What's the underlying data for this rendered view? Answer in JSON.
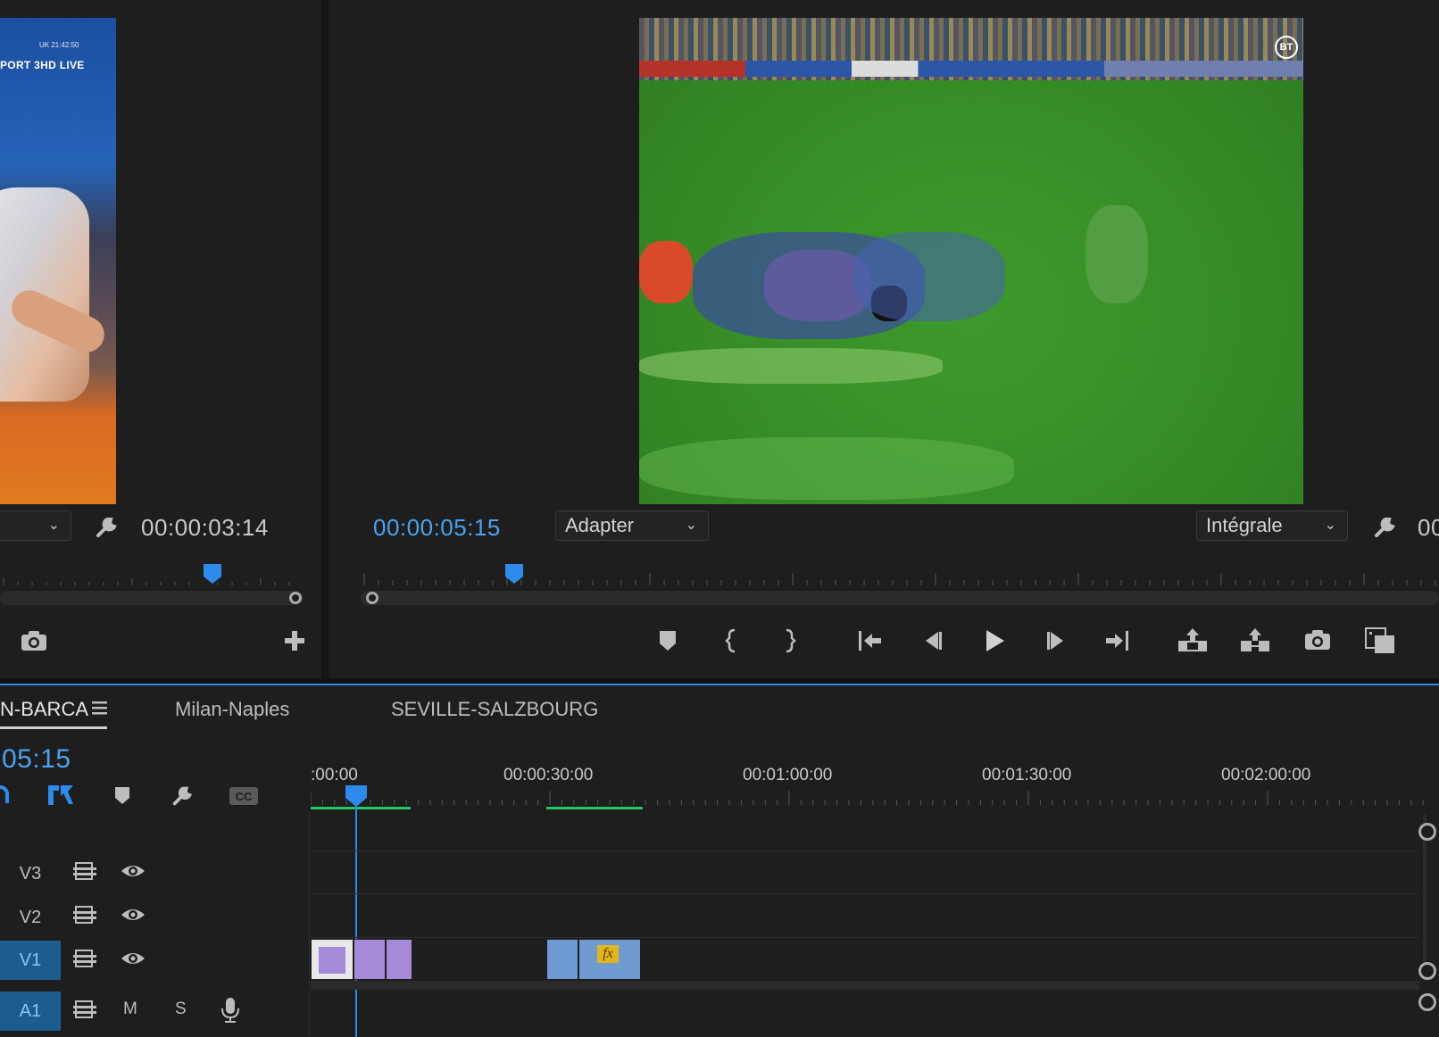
{
  "source_monitor": {
    "overlay_text": "PORT 3HD LIVE",
    "overlay_small": "UK 21:42:50",
    "timecode": "00:00:03:14",
    "controls": [
      "camera-icon",
      "add-icon",
      "wrench-icon"
    ]
  },
  "program_monitor": {
    "timecode": "00:00:05:15",
    "zoom_dropdown": "Adapter",
    "quality_dropdown": "Intégrale",
    "partial_timecode": "00",
    "logo_text": "BT",
    "playhead_fraction": 0.15,
    "transport": [
      "marker-icon",
      "mark-in-icon",
      "mark-out-icon",
      "go-to-in-icon",
      "step-back-icon",
      "play-icon",
      "step-forward-icon",
      "go-to-out-icon",
      "lift-icon",
      "extract-icon",
      "export-frame-icon",
      "comparison-view-icon"
    ]
  },
  "timeline": {
    "tabs": [
      "N-BARCA",
      "Milan-Naples",
      "SEVILLE-SALZBOURG"
    ],
    "timecode": "05:15",
    "ruler_labels": [
      ":00:00",
      "00:00:30:00",
      "00:01:00:00",
      "00:01:30:00",
      "00:02:00:00"
    ],
    "tracks": [
      {
        "label": "V3",
        "active": false
      },
      {
        "label": "V2",
        "active": false
      },
      {
        "label": "V1",
        "active": true
      },
      {
        "label": "A1",
        "active": true
      }
    ],
    "audio_buttons": {
      "mute": "M",
      "solo": "S"
    },
    "clip_fx_label": "fx",
    "colors": {
      "accent": "#2d8ceb",
      "clip_purple": "#a48ad8",
      "clip_blue": "#6f9bd2",
      "in_out_green": "#22c55e",
      "fx_badge": "#e3b51a"
    }
  }
}
